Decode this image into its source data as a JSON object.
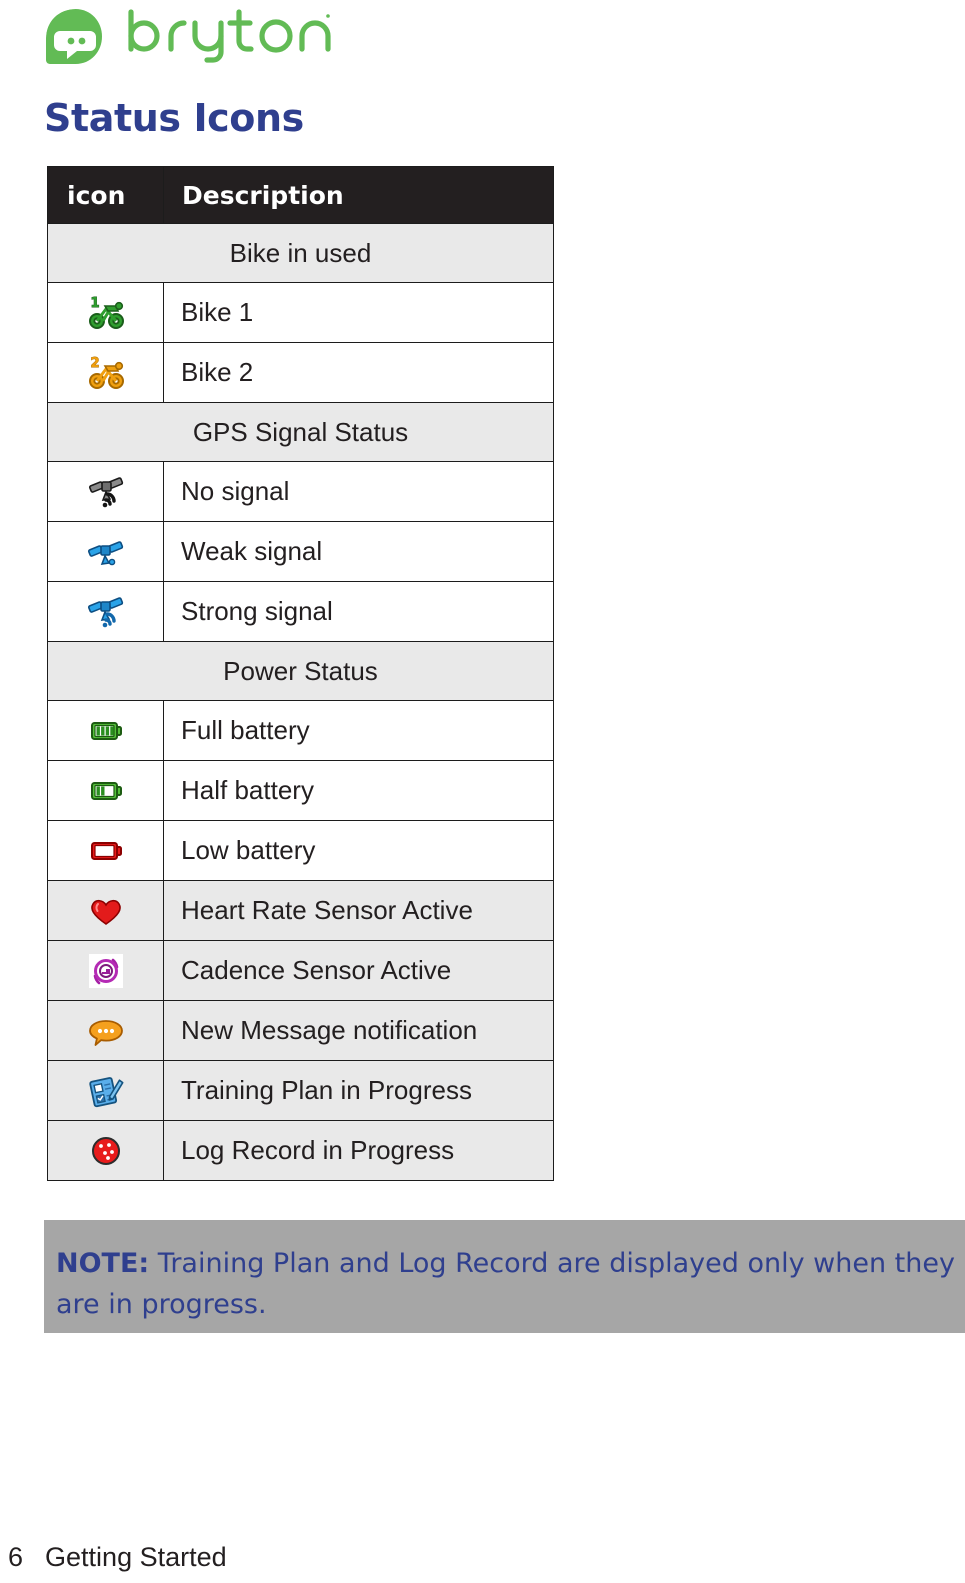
{
  "brand": {
    "logo_icon": "bryton-leaf-chat-logo",
    "wordmark": "bryton",
    "color": "#62bb55"
  },
  "page_title": "Status Icons",
  "table": {
    "headers": {
      "icon": "icon",
      "description": "Description"
    },
    "sections": [
      {
        "title": "Bike in used",
        "rows": [
          {
            "icon": "bike-1-icon",
            "label": "Bike 1",
            "shade": "white"
          },
          {
            "icon": "bike-2-icon",
            "label": "Bike 2",
            "shade": "white"
          }
        ]
      },
      {
        "title": "GPS Signal Status",
        "rows": [
          {
            "icon": "gps-no-signal-icon",
            "label": "No signal",
            "shade": "white"
          },
          {
            "icon": "gps-weak-signal-icon",
            "label": "Weak signal",
            "shade": "white"
          },
          {
            "icon": "gps-strong-signal-icon",
            "label": "Strong signal",
            "shade": "white"
          }
        ]
      },
      {
        "title": "Power Status",
        "rows": [
          {
            "icon": "battery-full-icon",
            "label": "Full battery",
            "shade": "white"
          },
          {
            "icon": "battery-half-icon",
            "label": "Half battery",
            "shade": "white"
          },
          {
            "icon": "battery-low-icon",
            "label": "Low battery",
            "shade": "white"
          },
          {
            "icon": "heart-rate-icon",
            "label": "Heart Rate Sensor Active",
            "shade": "gray"
          },
          {
            "icon": "cadence-sensor-icon",
            "label": "Cadence Sensor Active",
            "shade": "gray"
          },
          {
            "icon": "message-bubble-icon",
            "label": "New Message notification",
            "shade": "gray"
          },
          {
            "icon": "training-plan-icon",
            "label": "Training Plan in Progress",
            "shade": "gray"
          },
          {
            "icon": "log-record-icon",
            "label": "Log Record in Progress",
            "shade": "gray"
          }
        ]
      }
    ]
  },
  "note": {
    "label": "NOTE:",
    "text": " Training Plan and Log Record are displayed only when they are in progress.",
    "background": "#a6a6a6",
    "text_color": "#2f3f8e"
  },
  "footer": {
    "page_number": "6",
    "section": "Getting Started"
  },
  "colors": {
    "title_blue": "#2f3f8e",
    "header_black": "#231f20",
    "row_gray": "#e9e9e9",
    "brand_green": "#62bb55"
  }
}
